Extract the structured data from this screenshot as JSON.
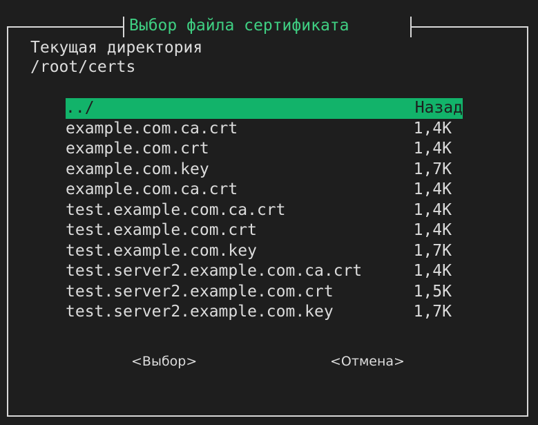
{
  "dialog": {
    "title": "Выбор файла сертификата",
    "current_dir_label": "Текущая директория",
    "current_dir_path": "/root/certs"
  },
  "files": [
    {
      "name": "../",
      "size": "Назад",
      "selected": true
    },
    {
      "name": "example.com.ca.crt",
      "size": "1,4K"
    },
    {
      "name": "example.com.crt",
      "size": "1,4K"
    },
    {
      "name": "example.com.key",
      "size": "1,7K"
    },
    {
      "name": "example.com.ca.crt",
      "size": "1,4K"
    },
    {
      "name": "test.example.com.ca.crt",
      "size": "1,4K"
    },
    {
      "name": "test.example.com.crt",
      "size": "1,4K"
    },
    {
      "name": "test.example.com.key",
      "size": "1,7K"
    },
    {
      "name": "test.server2.example.com.ca.crt",
      "size": "1,4K"
    },
    {
      "name": "test.server2.example.com.crt",
      "size": "1,5K"
    },
    {
      "name": "test.server2.example.com.key",
      "size": "1,7K"
    }
  ],
  "buttons": {
    "select_label": "<Выбор>",
    "cancel_label": "<Отмена>"
  },
  "colors": {
    "background": "#1e1e1e",
    "accent": "#12b36a",
    "title": "#3fcf82",
    "text": "#dcdcdc"
  }
}
